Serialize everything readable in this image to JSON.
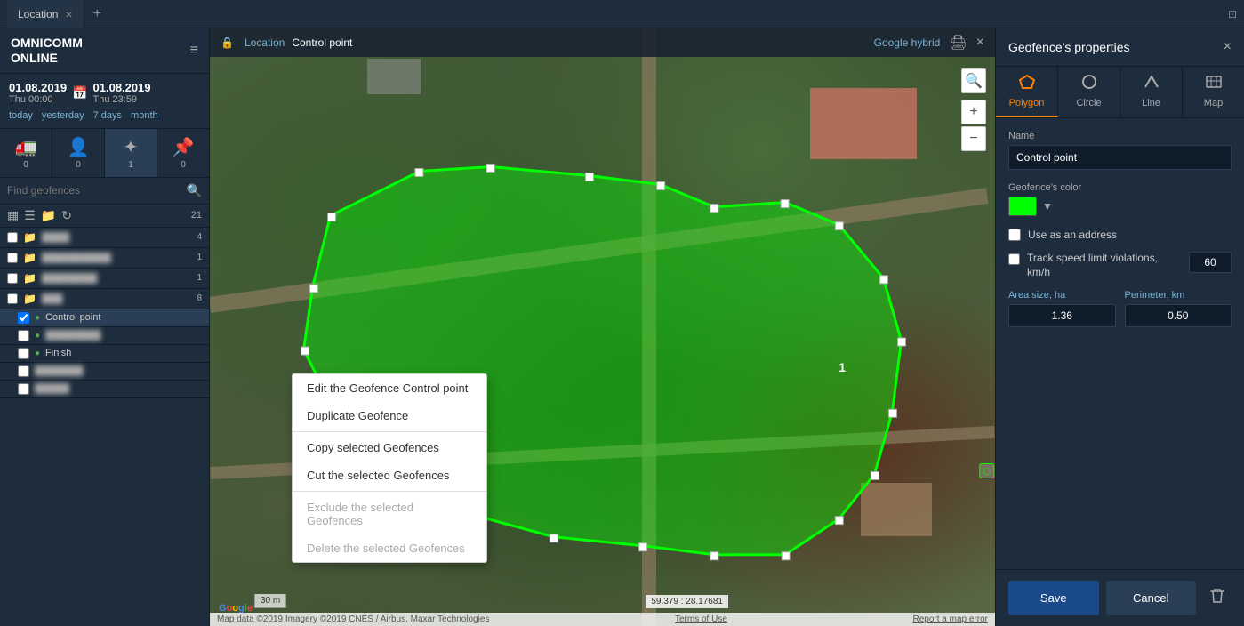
{
  "app": {
    "logo_line1": "OMNICOMM",
    "logo_line2": "ONLINE"
  },
  "tabs": [
    {
      "label": "Location",
      "active": true
    },
    {
      "label": "+"
    }
  ],
  "breadcrumb": {
    "lock_icon": "🔒",
    "items": [
      "Location",
      "Control point"
    ]
  },
  "date_range": {
    "start_date": "01.08.2019",
    "start_day": "Thu 00:00",
    "end_date": "01.08.2019",
    "end_day": "Thu 23:59"
  },
  "date_nav": {
    "items": [
      "today",
      "yesterday",
      "7 days",
      "month"
    ]
  },
  "icon_row": {
    "items": [
      {
        "icon": "🚛",
        "count": "0",
        "name": "trucks"
      },
      {
        "icon": "👤",
        "count": "0",
        "name": "drivers"
      },
      {
        "icon": "📍",
        "count": "1",
        "name": "geofences"
      },
      {
        "icon": "📌",
        "count": "0",
        "name": "points"
      }
    ]
  },
  "search": {
    "placeholder": "Find geofences"
  },
  "list": {
    "count": "21",
    "groups": [
      {
        "id": 1,
        "name": "blurred1",
        "count": "4",
        "blurred": true
      },
      {
        "id": 2,
        "name": "blurred2",
        "count": "1",
        "blurred": true
      },
      {
        "id": 3,
        "name": "blurred3",
        "count": "1",
        "blurred": true
      },
      {
        "id": 4,
        "name": "blurred4",
        "count": "8",
        "blurred": true
      }
    ],
    "special_items": [
      {
        "id": 5,
        "name": "Control point",
        "checked": true,
        "is_pin": true,
        "pin_color": "green"
      },
      {
        "id": 6,
        "name": "blurred5",
        "blurred": true
      },
      {
        "id": 7,
        "name": "Finish",
        "checked": false,
        "is_pin": true,
        "pin_color": "green"
      },
      {
        "id": 8,
        "name": "blurred6",
        "blurred": true
      },
      {
        "id": 9,
        "name": "blurred7",
        "blurred": true
      }
    ]
  },
  "context_menu": {
    "items": [
      {
        "label": "Edit the Geofence Control point",
        "enabled": true
      },
      {
        "label": "Duplicate Geofence",
        "enabled": true
      },
      {
        "label": "Copy selected Geofences",
        "enabled": true
      },
      {
        "label": "Cut the selected Geofences",
        "enabled": true
      },
      {
        "label": "Exclude the selected Geofences",
        "enabled": false
      },
      {
        "label": "Delete the selected Geofences",
        "enabled": false
      }
    ]
  },
  "map": {
    "scale_label": "30 m",
    "google_label": "Google",
    "coords": "59.379 : 28.17681",
    "attribution": "Map data ©2019 Imagery ©2019 CNES / Airbus, Maxar Technologies",
    "terms": "Terms of Use",
    "report": "Report a map error",
    "hybrid_link": "Google hybrid"
  },
  "right_panel": {
    "title": "Geofence's properties",
    "shape_tabs": [
      {
        "label": "Polygon",
        "icon": "⬡",
        "active": true
      },
      {
        "label": "Circle",
        "icon": "○",
        "active": false
      },
      {
        "label": "Line",
        "icon": "╱",
        "active": false
      },
      {
        "label": "Map",
        "icon": "🗺",
        "active": false
      }
    ],
    "name_label": "Name",
    "name_value": "Control point",
    "color_label": "Geofence's color",
    "color_value": "#00ff00",
    "use_as_address_label": "Use as an address",
    "track_speed_label": "Track speed limit violations,",
    "track_speed_label2": "km/h",
    "track_speed_value": "60",
    "area_label": "Area size, ha",
    "area_value": "1.36",
    "perimeter_label": "Perimeter, km",
    "perimeter_value": "0.50",
    "save_label": "Save",
    "cancel_label": "Cancel"
  }
}
